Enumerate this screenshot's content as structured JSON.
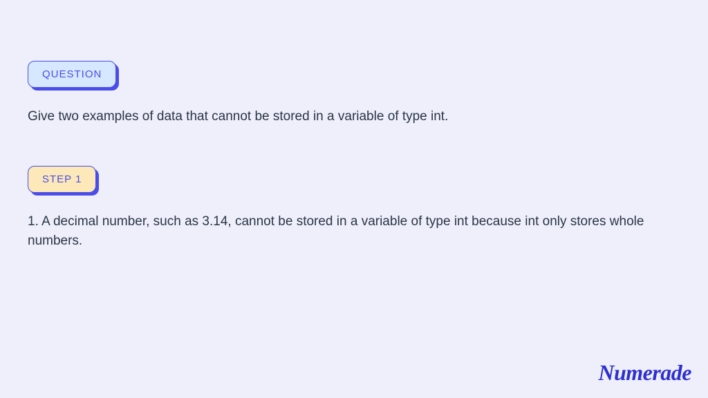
{
  "question": {
    "badge_label": "QUESTION",
    "text": "Give two examples of data that cannot be stored in a variable of type int."
  },
  "step": {
    "badge_label": "STEP 1",
    "text": "1. A decimal number, such as 3.14, cannot be stored in a variable of type int because int only stores whole numbers."
  },
  "brand": "Numerade"
}
